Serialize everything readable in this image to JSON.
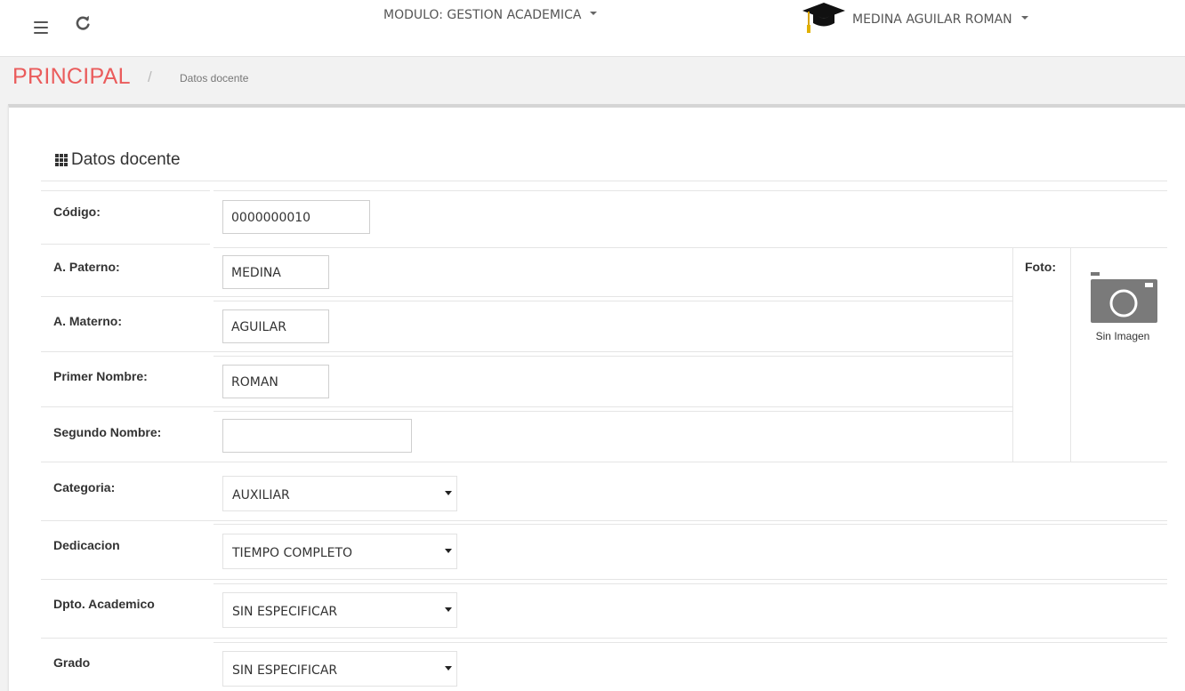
{
  "navbar": {
    "module_label": "MODULO: GESTION ACADEMICA",
    "user_name": "MEDINA AGUILAR ROMAN"
  },
  "breadcrumb": {
    "main": "PRINCIPAL",
    "separator": "/",
    "current": "Datos docente"
  },
  "card": {
    "title": "Datos docente"
  },
  "form": {
    "codigo": {
      "label": "Código:",
      "value": "0000000010"
    },
    "paterno": {
      "label": "A. Paterno:",
      "value": "MEDINA"
    },
    "materno": {
      "label": "A. Materno:",
      "value": "AGUILAR"
    },
    "primer_nombre": {
      "label": "Primer Nombre:",
      "value": "ROMAN"
    },
    "segundo_nombre": {
      "label": "Segundo Nombre:",
      "value": ""
    },
    "categoria": {
      "label": "Categoria:",
      "value": "AUXILIAR"
    },
    "dedicacion": {
      "label": "Dedicacion",
      "value": "TIEMPO COMPLETO"
    },
    "dpto": {
      "label": "Dpto. Academico",
      "value": "SIN ESPECIFICAR"
    },
    "grado": {
      "label": "Grado",
      "value": "SIN ESPECIFICAR"
    }
  },
  "photo": {
    "label": "Foto:",
    "caption": "Sin Imagen",
    "icon": "camera-icon"
  },
  "colors": {
    "breadcrumb_accent": "#ea5c5c",
    "card_top_border": "#d5d5d5"
  }
}
